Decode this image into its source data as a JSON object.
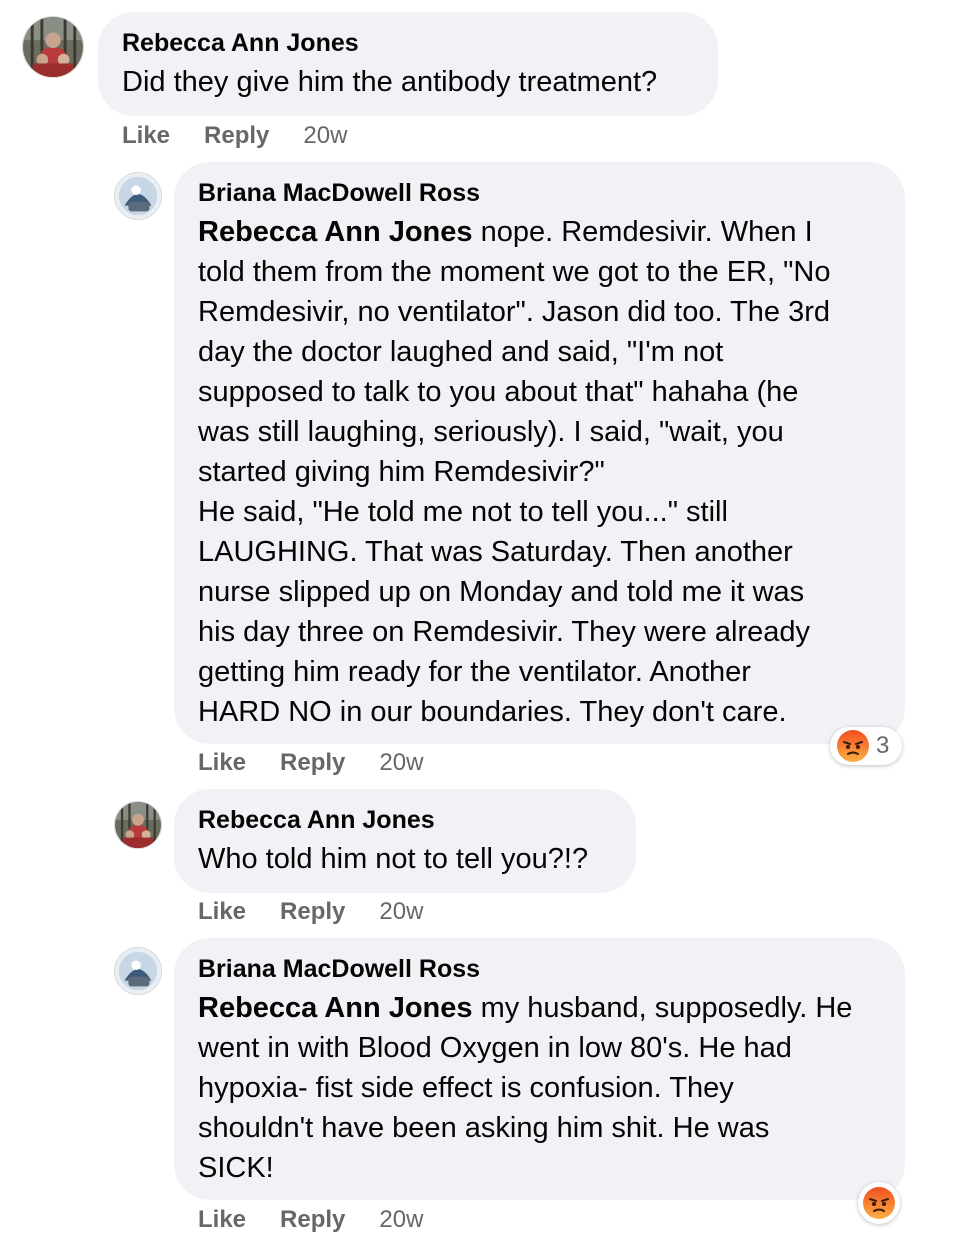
{
  "comments": [
    {
      "author": "Rebecca Ann Jones",
      "mention": "",
      "text": "Did they give him the antibody treatment?",
      "like": "Like",
      "reply": "Reply",
      "time": "20w"
    },
    {
      "author": "Briana MacDowell Ross",
      "mention": "Rebecca Ann Jones",
      "text": " nope. Remdesivir. When I\ntold them from the moment we got to the ER, \"No\nRemdesivir, no ventilator\". Jason did too. The 3rd\nday the doctor laughed and said, \"I'm not\nsupposed to talk to you about that\" hahaha (he\nwas still laughing, seriously). I said, \"wait, you\nstarted giving him Remdesivir?\"\nHe said, \"He told me not to tell you...\" still\nLAUGHING. That was Saturday. Then another\nnurse slipped up on Monday and told me it was\nhis day three on Remdesivir. They were already\ngetting him ready for the ventilator. Another\nHARD NO in our boundaries. They don't care.",
      "like": "Like",
      "reply": "Reply",
      "time": "20w",
      "reaction_count": "3",
      "reaction_icon": "angry-reaction-icon"
    },
    {
      "author": "Rebecca Ann Jones",
      "mention": "",
      "text": "Who told him not to tell you?!?",
      "like": "Like",
      "reply": "Reply",
      "time": "20w"
    },
    {
      "author": "Briana MacDowell Ross",
      "mention": "Rebecca Ann Jones",
      "text": " my husband, supposedly. He\nwent in with Blood Oxygen in low 80's. He had\nhypoxia- fist side effect is confusion. They\nshouldn't have been asking him shit. He was\nSICK!",
      "like": "Like",
      "reply": "Reply",
      "time": "20w",
      "reaction_icon": "angry-reaction-icon"
    }
  ],
  "colors": {
    "bubble": "#f0f2f5",
    "meta_text": "#65676b",
    "text": "#050505",
    "angry_top": "#f24e1e",
    "angry_bottom": "#fcb045"
  }
}
